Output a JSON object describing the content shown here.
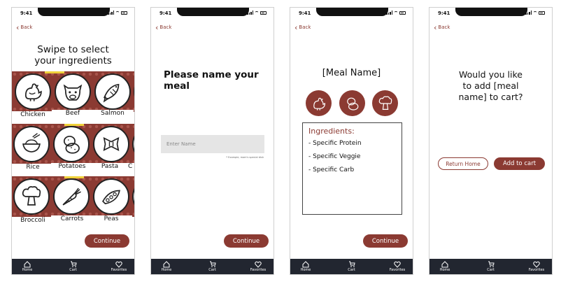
{
  "status": {
    "time": "9:41"
  },
  "back_label": "Back",
  "nav": {
    "home": "Home",
    "cart": "Cart",
    "favorites": "Favorites"
  },
  "screen1": {
    "title_line1": "Swipe to select",
    "title_line2": "your ingredients",
    "rows": [
      [
        "Chicken",
        "Beef",
        "Salmon"
      ],
      [
        "Rice",
        "Potatoes",
        "Pasta",
        "C"
      ],
      [
        "Broccoli",
        "Carrots",
        "Peas"
      ]
    ],
    "continue": "Continue"
  },
  "screen2": {
    "title_line1": "Please name your",
    "title_line2": "meal",
    "placeholder": "Enter Name",
    "hint": "* Example, mom's special dish",
    "continue": "Continue"
  },
  "screen3": {
    "title": "[Meal Name]",
    "ingredients_heading": "Ingredients:",
    "items": [
      "-  Specific Protein",
      "-  Specific Veggie",
      "-  Specific Carb"
    ],
    "continue": "Continue"
  },
  "screen4": {
    "line1": "Would you like",
    "line2": "to add [meal",
    "line3": "name] to cart?",
    "return_home": "Return Home",
    "add_to_cart": "Add to cart"
  },
  "colors": {
    "accent": "#8b3a32",
    "nav": "#222630",
    "highlight": "#f0d23a"
  }
}
